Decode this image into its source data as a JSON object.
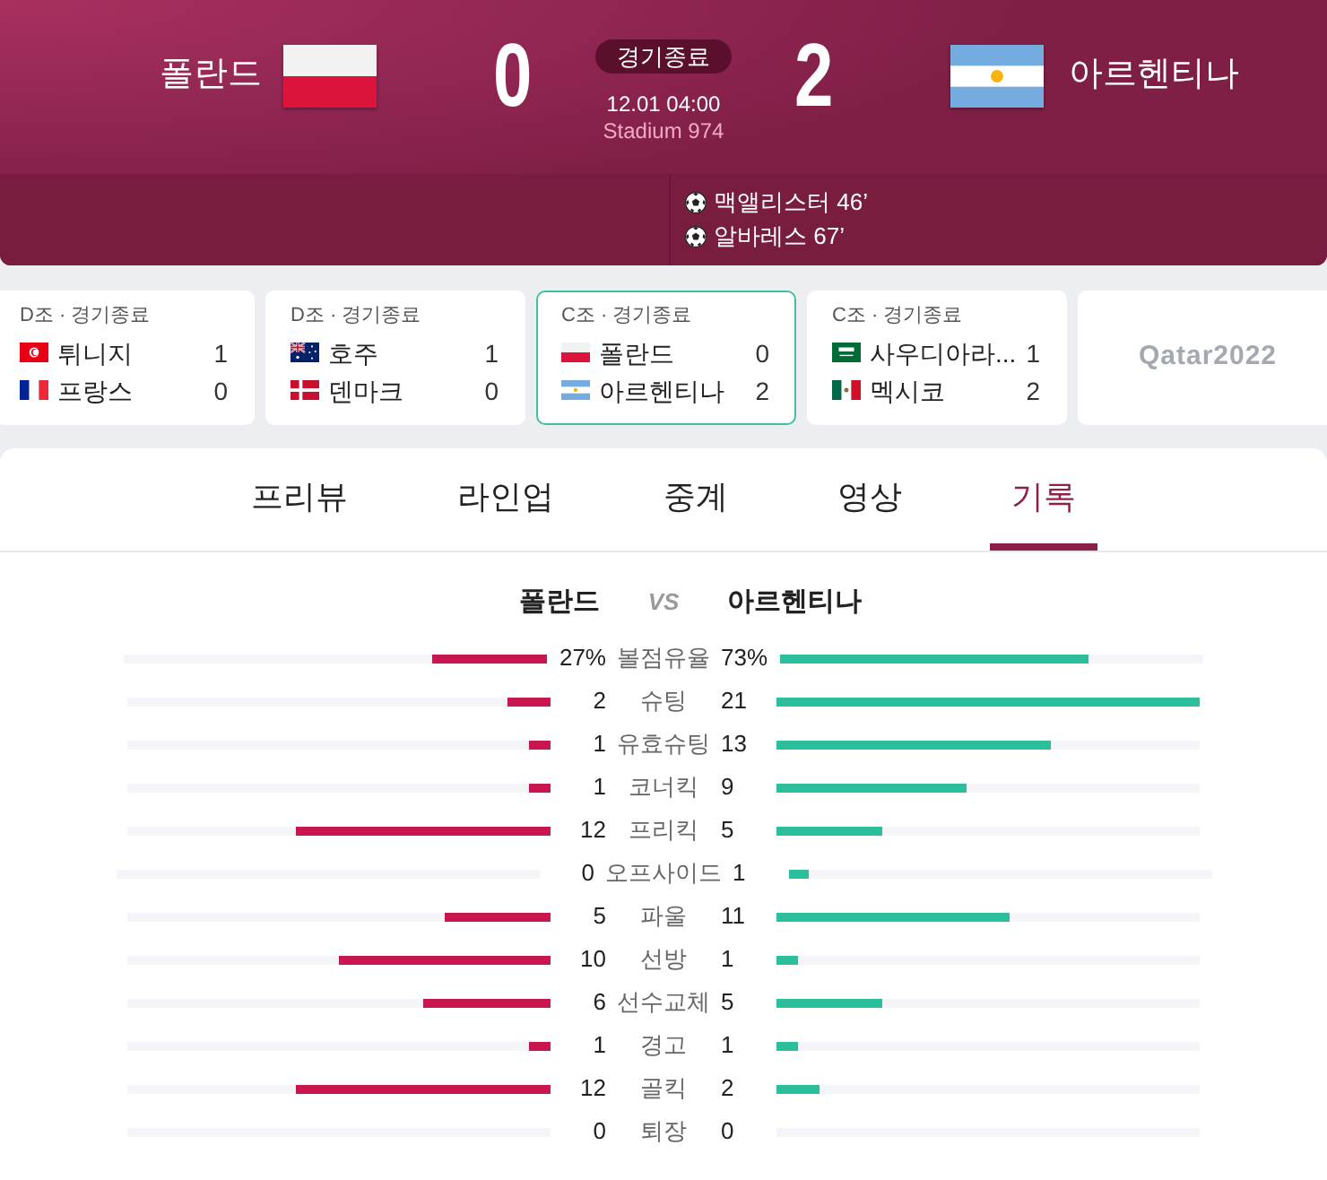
{
  "header": {
    "home": {
      "name": "폴란드",
      "kind": "poland",
      "score": "0"
    },
    "away": {
      "name": "아르헨티나",
      "kind": "argentina",
      "score": "2"
    },
    "status": "경기종료",
    "datetime": "12.01 04:00",
    "venue": "Stadium 974",
    "goals": [
      {
        "text": "맥앨리스터 46’"
      },
      {
        "text": "알바레스 67’"
      }
    ]
  },
  "match_cards": [
    {
      "kind": "match",
      "group": "D조 · 경기종료",
      "selected": false,
      "teams": [
        {
          "name": "튀니지",
          "kind": "tunisia",
          "score": "1"
        },
        {
          "name": "프랑스",
          "kind": "france",
          "score": "0"
        }
      ]
    },
    {
      "kind": "match",
      "group": "D조 · 경기종료",
      "selected": false,
      "teams": [
        {
          "name": "호주",
          "kind": "australia",
          "score": "1"
        },
        {
          "name": "덴마크",
          "kind": "denmark",
          "score": "0"
        }
      ]
    },
    {
      "kind": "match",
      "group": "C조 · 경기종료",
      "selected": true,
      "teams": [
        {
          "name": "폴란드",
          "kind": "poland",
          "score": "0"
        },
        {
          "name": "아르헨티나",
          "kind": "argentina",
          "score": "2"
        }
      ]
    },
    {
      "kind": "match",
      "group": "C조 · 경기종료",
      "selected": false,
      "teams": [
        {
          "name": "사우디아라...",
          "kind": "saudi",
          "score": "1"
        },
        {
          "name": "멕시코",
          "kind": "mexico",
          "score": "2"
        }
      ]
    },
    {
      "kind": "logo",
      "text": "Qatar2022"
    }
  ],
  "tabs": [
    {
      "label": "프리뷰",
      "selected": false
    },
    {
      "label": "라인업",
      "selected": false
    },
    {
      "label": "중계",
      "selected": false
    },
    {
      "label": "영상",
      "selected": false
    },
    {
      "label": "기록",
      "selected": true
    }
  ],
  "comparison": {
    "home": "폴란드",
    "vs": "VS",
    "away": "아르헨티나"
  },
  "stats": [
    {
      "label": "볼점유율",
      "home": {
        "value": "27%",
        "level": 0.27
      },
      "away": {
        "value": "73%",
        "level": 0.73
      }
    },
    {
      "label": "슈팅",
      "home": {
        "value": "2",
        "level": 0.1
      },
      "away": {
        "value": "21",
        "level": 1
      }
    },
    {
      "label": "유효슈팅",
      "home": {
        "value": "1",
        "level": 0.05
      },
      "away": {
        "value": "13",
        "level": 0.65
      }
    },
    {
      "label": "코너킥",
      "home": {
        "value": "1",
        "level": 0.05
      },
      "away": {
        "value": "9",
        "level": 0.45
      }
    },
    {
      "label": "프리킥",
      "home": {
        "value": "12",
        "level": 0.6
      },
      "away": {
        "value": "5",
        "level": 0.25
      }
    },
    {
      "label": "오프사이드",
      "home": {
        "value": "0",
        "level": 0
      },
      "away": {
        "value": "1",
        "level": 0.05
      }
    },
    {
      "label": "파울",
      "home": {
        "value": "5",
        "level": 0.25
      },
      "away": {
        "value": "11",
        "level": 0.55
      }
    },
    {
      "label": "선방",
      "home": {
        "value": "10",
        "level": 0.5
      },
      "away": {
        "value": "1",
        "level": 0.05
      }
    },
    {
      "label": "선수교체",
      "home": {
        "value": "6",
        "level": 0.3
      },
      "away": {
        "value": "5",
        "level": 0.25
      }
    },
    {
      "label": "경고",
      "home": {
        "value": "1",
        "level": 0.05
      },
      "away": {
        "value": "1",
        "level": 0.05
      }
    },
    {
      "label": "골킥",
      "home": {
        "value": "12",
        "level": 0.6
      },
      "away": {
        "value": "2",
        "level": 0.1
      }
    },
    {
      "label": "퇴장",
      "home": {
        "value": "0",
        "level": 0
      },
      "away": {
        "value": "0",
        "level": 0
      }
    }
  ]
}
